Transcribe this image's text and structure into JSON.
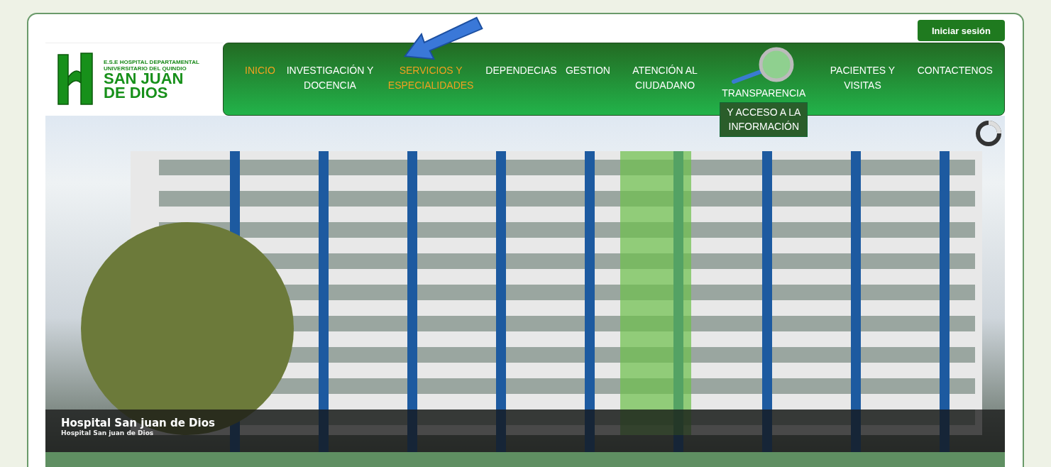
{
  "login_button": "Iniciar sesión",
  "logo": {
    "subtitle": "E.S.E HOSPITAL DEPARTAMENTAL UNIVERSITARIO DEL QUINDIO",
    "name_line1": "SAN JUAN",
    "name_line2": "DE DIOS"
  },
  "menu": [
    {
      "label": "INICIO",
      "selected": true
    },
    {
      "label": "INVESTIGACIÓN Y DOCENCIA",
      "selected": false
    },
    {
      "label": "SERVICIOS Y ESPECIALIDADES",
      "selected": true
    },
    {
      "label": "DEPENDECIAS",
      "selected": false
    },
    {
      "label": "GESTION",
      "selected": false
    },
    {
      "label": "ATENCIÓN AL CIUDADANO",
      "selected": false
    },
    {
      "label": "TRANSPARENCIA",
      "selected": false,
      "dropdown": "Y ACCESO A LA INFORMACIÓN"
    },
    {
      "label": "PACIENTES Y VISITAS",
      "selected": false
    },
    {
      "label": "CONTACTENOS",
      "selected": false
    }
  ],
  "slide": {
    "title": "Hospital San juan de Dios",
    "subtitle": "Hospital San juan de Dios"
  }
}
